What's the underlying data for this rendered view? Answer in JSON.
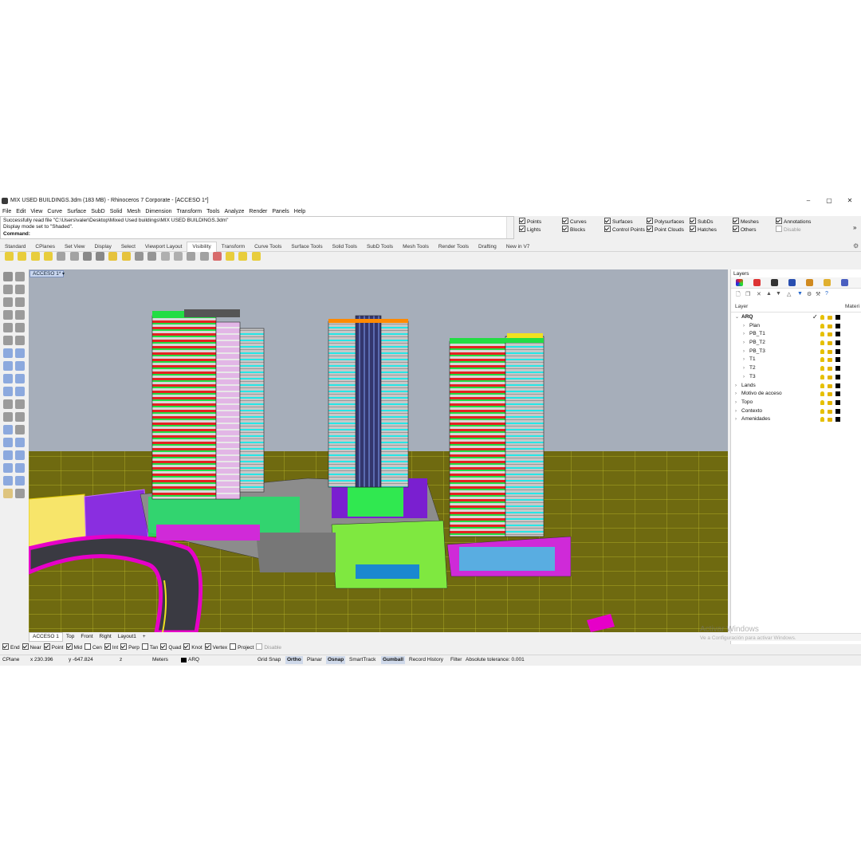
{
  "window": {
    "title": "MIX USED BUILDINGS.3dm (183 MB) - Rhinoceros 7 Corporate - [ACCESO 1*]",
    "minimize": "–",
    "maximize": "▢",
    "close": "✕"
  },
  "menu": [
    "File",
    "Edit",
    "View",
    "Curve",
    "Surface",
    "SubD",
    "Solid",
    "Mesh",
    "Dimension",
    "Transform",
    "Tools",
    "Analyze",
    "Render",
    "Panels",
    "Help"
  ],
  "command": {
    "history1": "Successfully read file \"C:\\Users\\valer\\Desktop\\Mixed Used buildings\\MIX USED BUILDINGS.3dm\"",
    "history2": "Display mode set to \"Shaded\".",
    "prompt": "Command:"
  },
  "selection_filters": [
    {
      "label": "Points",
      "checked": true
    },
    {
      "label": "Curves",
      "checked": true
    },
    {
      "label": "Surfaces",
      "checked": true
    },
    {
      "label": "Polysurfaces",
      "checked": true
    },
    {
      "label": "SubDs",
      "checked": true
    },
    {
      "label": "Meshes",
      "checked": true
    },
    {
      "label": "Annotations",
      "checked": true
    },
    {
      "label": "Lights",
      "checked": true
    },
    {
      "label": "Blocks",
      "checked": true
    },
    {
      "label": "Control Points",
      "checked": true
    },
    {
      "label": "Point Clouds",
      "checked": true
    },
    {
      "label": "Hatches",
      "checked": true
    },
    {
      "label": "Others",
      "checked": true
    },
    {
      "label": "Disable",
      "checked": false
    }
  ],
  "toolbar_tabs": [
    "Standard",
    "CPlanes",
    "Set View",
    "Display",
    "Select",
    "Viewport Layout",
    "Visibility",
    "Transform",
    "Curve Tools",
    "Surface Tools",
    "Solid Tools",
    "SubD Tools",
    "Mesh Tools",
    "Render Tools",
    "Drafting",
    "New in V7"
  ],
  "active_toolbar_tab": "Visibility",
  "viewport": {
    "label": "ACCESO 1*",
    "arrow": "▾"
  },
  "view_tabs": [
    "ACCESO 1",
    "Top",
    "Front",
    "Right",
    "Layout1"
  ],
  "view_tab_add": "+",
  "osnaps": [
    {
      "label": "End",
      "checked": true
    },
    {
      "label": "Near",
      "checked": true
    },
    {
      "label": "Point",
      "checked": true
    },
    {
      "label": "Mid",
      "checked": true
    },
    {
      "label": "Cen",
      "checked": false
    },
    {
      "label": "Int",
      "checked": true
    },
    {
      "label": "Perp",
      "checked": true
    },
    {
      "label": "Tan",
      "checked": false
    },
    {
      "label": "Quad",
      "checked": true
    },
    {
      "label": "Knot",
      "checked": true
    },
    {
      "label": "Vertex",
      "checked": true
    },
    {
      "label": "Project",
      "checked": false
    },
    {
      "label": "Disable",
      "checked": false
    }
  ],
  "status": {
    "cplane": "CPlane",
    "x": "x 230.396",
    "y": "y -647.824",
    "z": "z",
    "units": "Meters",
    "layer": "ARQ",
    "grid_snap": "Grid Snap",
    "ortho": "Ortho",
    "planar": "Planar",
    "osnap": "Osnap",
    "smarttrack": "SmartTrack",
    "gumball": "Gumball",
    "record_history": "Record History",
    "filter": "Filter",
    "tolerance": "Absolute tolerance: 0.001"
  },
  "layers_panel": {
    "title": "Layers",
    "col_layer": "Layer",
    "col_material": "Materi",
    "rows": [
      {
        "name": "ARQ",
        "level": 0,
        "expanded": true,
        "current": true
      },
      {
        "name": "Plan",
        "level": 1,
        "expanded": false,
        "current": false
      },
      {
        "name": "PB_T1",
        "level": 1,
        "expanded": false,
        "current": false
      },
      {
        "name": "PB_T2",
        "level": 1,
        "expanded": false,
        "current": false
      },
      {
        "name": "PB_T3",
        "level": 1,
        "expanded": false,
        "current": false
      },
      {
        "name": "T1",
        "level": 1,
        "expanded": false,
        "current": false
      },
      {
        "name": "T2",
        "level": 1,
        "expanded": false,
        "current": false
      },
      {
        "name": "T3",
        "level": 1,
        "expanded": false,
        "current": false
      },
      {
        "name": "Lands",
        "level": 0,
        "expanded": false,
        "current": false
      },
      {
        "name": "Motivo de acceso",
        "level": 0,
        "expanded": false,
        "current": false
      },
      {
        "name": "Topo",
        "level": 0,
        "expanded": false,
        "current": false
      },
      {
        "name": "Contexto",
        "level": 0,
        "expanded": false,
        "current": false
      },
      {
        "name": "Amenidades",
        "level": 0,
        "expanded": false,
        "current": false
      }
    ]
  },
  "watermark": {
    "line1": "Activar Windows",
    "line2": "Ve a Configuración para activar Windows."
  }
}
